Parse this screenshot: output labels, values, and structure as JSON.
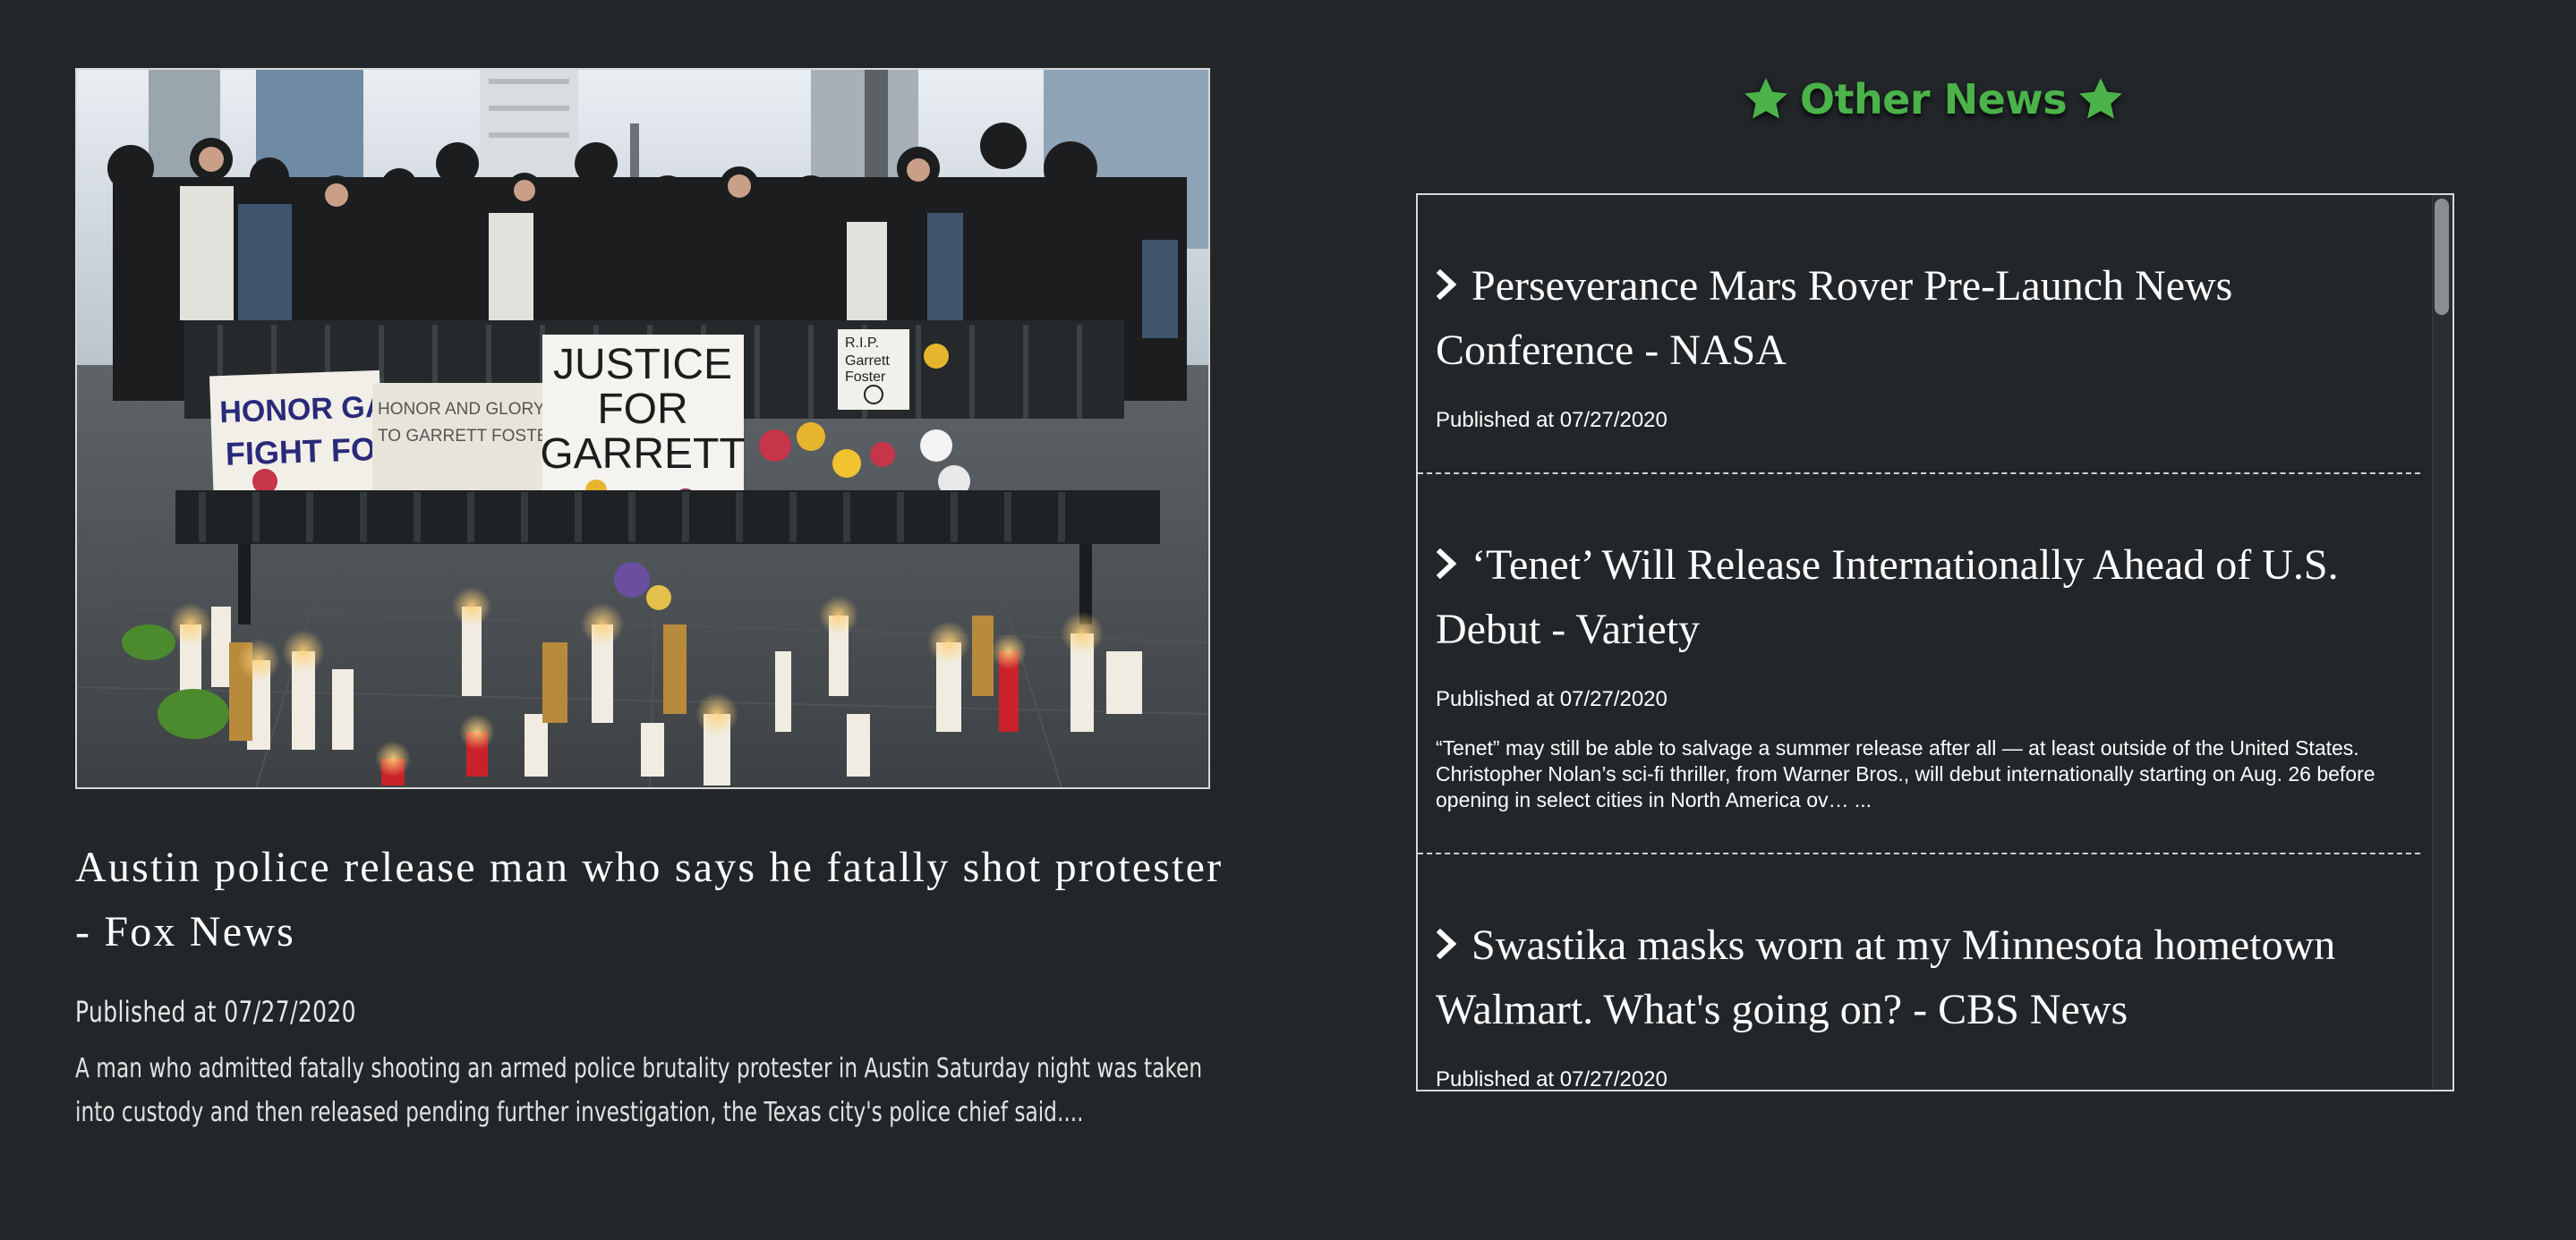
{
  "featured": {
    "image_alt": "Memorial with candles, flowers and signs on a bench; crowd standing behind",
    "sign_texts": [
      "HONOR GARRETT",
      "FIGHT FOR",
      "HONOR AND GLORY",
      "TO GARRETT FOSTER",
      "JUSTICE",
      "FOR",
      "GARRETT",
      "R.I.P.",
      "Garrett",
      "Foster"
    ],
    "title": "Austin police release man who says he fatally shot protester - Fox News",
    "published": "Published at 07/27/2020",
    "description": "A man who admitted fatally shooting an armed police brutality protester in Austin Saturday night was taken into custody and then released pending further investigation, the Texas city's police chief said...."
  },
  "other_news": {
    "heading": "Other News",
    "icon": "star-icon",
    "accent_color": "#4bb34a",
    "items": [
      {
        "title": "Perseverance Mars Rover Pre-Launch News Conference - NASA",
        "published": "Published at 07/27/2020",
        "description": ""
      },
      {
        "title": "‘Tenet’ Will Release Internationally Ahead of U.S. Debut - Variety",
        "published": "Published at 07/27/2020",
        "description": "“Tenet” may still be able to salvage a summer release after all — at least outside of the United States. Christopher Nolan’s sci-fi thriller, from Warner Bros., will debut internationally starting on Aug. 26 before opening in select cities in North America ov… ..."
      },
      {
        "title": "Swastika masks worn at my Minnesota hometown Walmart. What's going on? - CBS News",
        "published": "Published at 07/27/2020",
        "description": ""
      }
    ]
  }
}
